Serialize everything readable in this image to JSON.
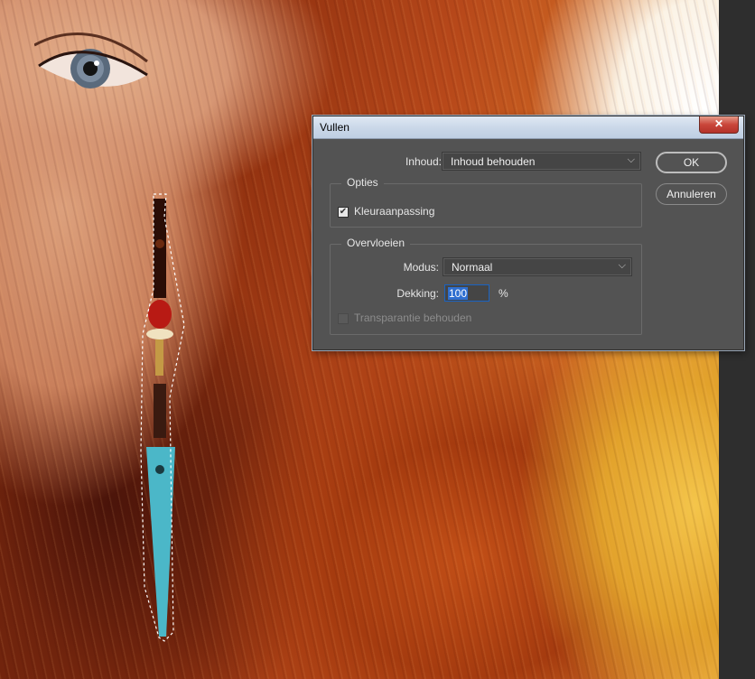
{
  "dialog": {
    "title": "Vullen",
    "close_symbol": "✕",
    "content_label": "Inhoud:",
    "content_value": "Inhoud behouden",
    "options_legend": "Opties",
    "color_adapt_label": "Kleuraanpassing",
    "color_adapt_checked": true,
    "blending_legend": "Overvloeien",
    "mode_label": "Modus:",
    "mode_value": "Normaal",
    "opacity_label": "Dekking:",
    "opacity_value": "100",
    "opacity_unit": "%",
    "preserve_transparency_label": "Transparantie behouden",
    "preserve_transparency_checked": false,
    "ok_label": "OK",
    "cancel_label": "Annuleren",
    "chevron_symbol": "⌵"
  },
  "colors": {
    "dialog_bg": "#535353",
    "field_bg": "#454545",
    "selection_blue": "#2f6fd0"
  }
}
